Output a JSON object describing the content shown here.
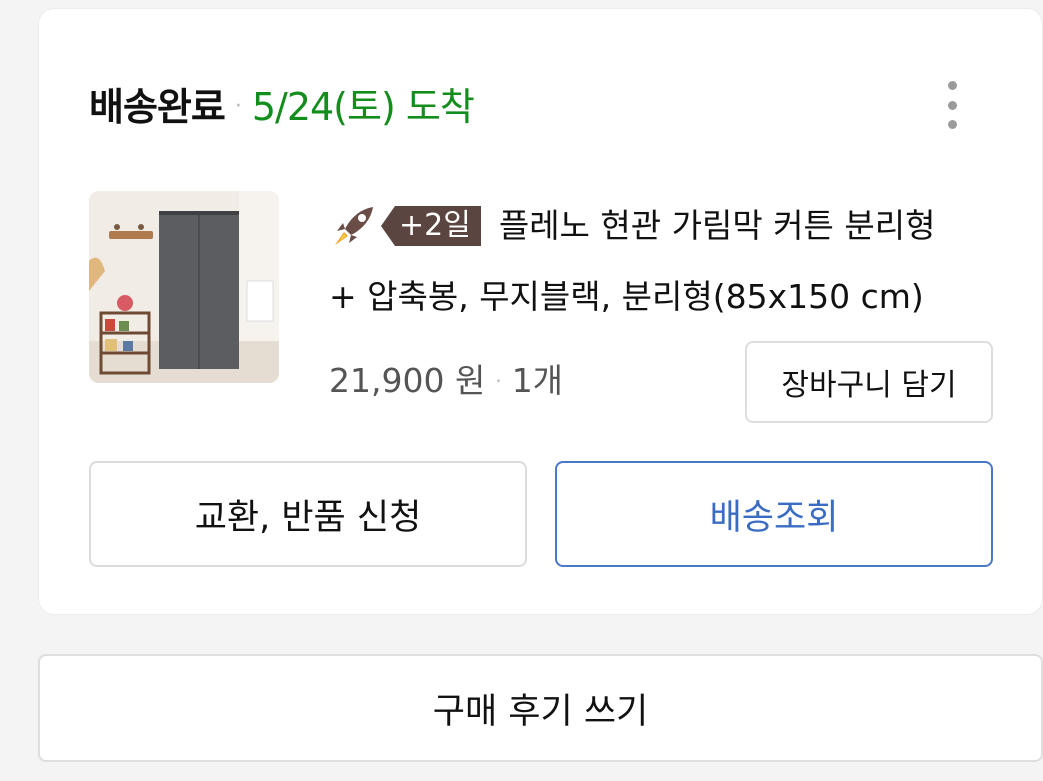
{
  "order": {
    "status": "배송완료",
    "separator": "·",
    "arrival": "5/24(토) 도착",
    "more_icon": "vertical-ellipsis-icon"
  },
  "product": {
    "image": "door-curtain-product-photo",
    "badge_icon": "rocket-icon",
    "badge_text": "+2일",
    "title_line1": "플레노 현관 가림막 커튼 분리형",
    "title_line2": "+ 압축봉, 무지블랙, 분리형(85x150 cm)",
    "price": "21,900 원",
    "price_separator": "·",
    "quantity": "1개"
  },
  "actions": {
    "add_to_cart": "장바구니 담기",
    "exchange_return": "교환, 반품 신청",
    "track_delivery": "배송조회",
    "write_review": "구매 후기 쓰기"
  },
  "colors": {
    "arrival": "#138e1d",
    "track_button": "#3a6cc4",
    "badge": "#5a4541"
  }
}
